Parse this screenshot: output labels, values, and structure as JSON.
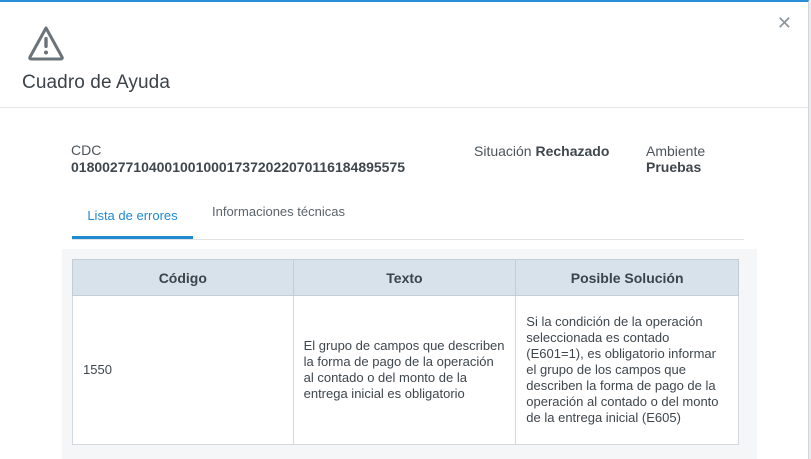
{
  "dialog": {
    "title": "Cuadro de Ayuda",
    "close_icon": "close-icon",
    "warning_icon": "warning-triangle-icon",
    "accent_color": "#1f8ad2"
  },
  "info": {
    "cdc_label": "CDC",
    "cdc_value": "01800277104001001000173720220701161848955 75",
    "situacion_label": "Situación",
    "situacion_value": "Rechazado",
    "ambiente_label": "Ambiente",
    "ambiente_value": "Pruebas"
  },
  "tabs": [
    {
      "label": "Lista de errores",
      "active": true
    },
    {
      "label": "Informaciones técnicas",
      "active": false
    }
  ],
  "table": {
    "headers": [
      "Código",
      "Texto",
      "Posible Solución"
    ],
    "rows": [
      {
        "codigo": "1550",
        "texto": "El grupo de campos que describen la forma de pago de la operación al contado o del monto de la entrega inicial es obligatorio",
        "solucion": "Si la condición de la operación seleccionada es contado (E601=1), es obligatorio informar el grupo de los campos que describen la forma de pago de la operación al contado o del monto de la entrega inicial (E605)"
      }
    ]
  }
}
